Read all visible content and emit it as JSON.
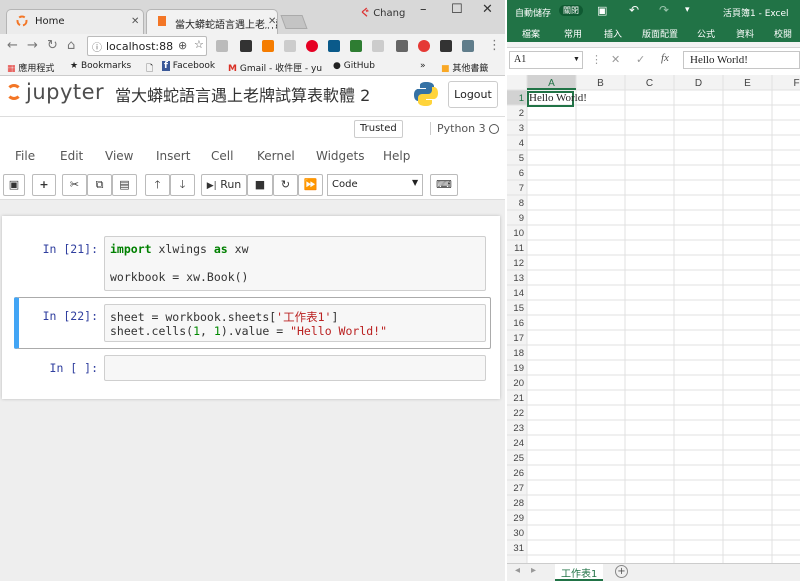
{
  "browser": {
    "tabs": [
      {
        "label": "Home"
      },
      {
        "label": "當大蟒蛇語言遇上老牌試"
      }
    ],
    "user_label": "Chang",
    "url": "localhost:88",
    "bookmarks": [
      "應用程式",
      "Bookmarks",
      "Facebook",
      "Gmail - 收件匣 - yu",
      "GitHub",
      "»",
      "其他書籤"
    ]
  },
  "jupyter": {
    "logo_text": "jupyter",
    "notebook_title": "當大蟒蛇語言遇上老牌試算表軟體 2",
    "logout_label": "Logout",
    "trusted_label": "Trusted",
    "kernel_name": "Python 3",
    "menu": [
      "File",
      "Edit",
      "View",
      "Insert",
      "Cell",
      "Kernel",
      "Widgets",
      "Help"
    ],
    "run_label": "Run",
    "cell_type": "Code",
    "cells": [
      {
        "prompt": "In [21]:"
      },
      {
        "prompt": "In [22]:"
      },
      {
        "prompt": "In [ ]:"
      }
    ]
  },
  "excel": {
    "title": "活頁簿1 - Excel",
    "autosave": "自動儲存",
    "autosave_state": "關閉",
    "ribbon_tabs": [
      "檔案",
      "常用",
      "插入",
      "版面配置",
      "公式",
      "資料",
      "校閱"
    ],
    "name_box": "A1",
    "fx_label": "fx",
    "formula_value": "Hello World!",
    "columns": [
      "A",
      "B",
      "C",
      "D",
      "E",
      "F"
    ],
    "cell_a1": "Hello World!",
    "sheet_tab": "工作表1",
    "colors": {
      "accent": "#217346",
      "jupyter_orange": "#f37626",
      "prompt": "#303f9f",
      "selected_cell": "#42a5f5"
    }
  }
}
